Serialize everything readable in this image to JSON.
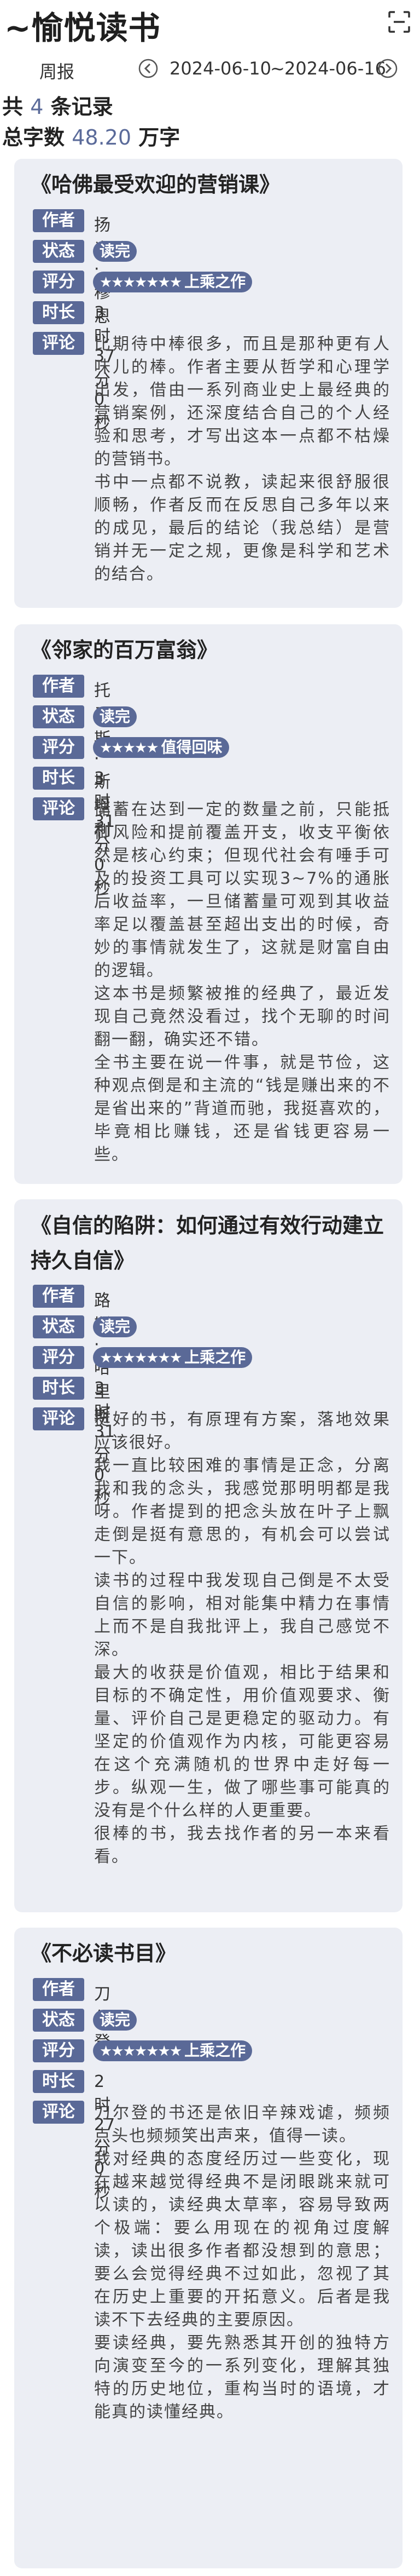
{
  "header": {
    "title": "~愉悦读书",
    "scan_icon": "scan-icon"
  },
  "range": {
    "label": "周报",
    "start": "2024-06-10",
    "separator": "~",
    "end": "2024-06-16",
    "prev_icon": "chevron-left-circle-icon",
    "next_icon": "chevron-right-circle-icon"
  },
  "summary": {
    "count_prefix": "共",
    "count": "4",
    "count_suffix": "条记录",
    "words_prefix": "总字数",
    "words": "48.20",
    "words_suffix": "万字"
  },
  "labels": {
    "author": "作者",
    "status": "状态",
    "rating": "评分",
    "duration": "时长",
    "review": "评论"
  },
  "colors": {
    "accent": "#5a6997",
    "card_bg": "#eceef4"
  },
  "books": [
    {
      "title": "《哈佛最受欢迎的营销课》",
      "author": "扬米·穆恩",
      "status": "读完",
      "stars": "★★★★★★★",
      "rating_text": "上乘之作",
      "duration": "3时37分0秒",
      "review": [
        "比期待中棒很多，而且是那种更有人味儿的棒。作者主要从哲学和心理学出发，借由一系列商业史上最经典的营销案例，还深度结合自己的个人经验和思考，才写出这本一点都不枯燥的营销书。",
        "书中一点都不说教，读起来很舒服很顺畅，作者反而在反思自己多年以来的成见，最后的结论（我总结）是营销并无一定之规，更像是科学和艺术的结合。"
      ]
    },
    {
      "title": "《邻家的百万富翁》",
      "author": "托马斯·斯坦利",
      "status": "读完",
      "stars": "★★★★★",
      "rating_text": "值得回味",
      "duration": "3时31分0秒",
      "review": [
        "储蓄在达到一定的数量之前，只能抵御风险和提前覆盖开支，收支平衡依然是核心约束；但现代社会有唾手可及的投资工具可以实现3~7%的通胀后收益率，一旦储蓄量可观到其收益率足以覆盖甚至超出支出的时候，奇妙的事情就发生了，这就是财富自由的逻辑。",
        "这本书是频繁被推的经典了，最近发现自己竟然没看过，找个无聊的时间翻一翻，确实还不错。",
        "全书主要在说一件事，就是节俭，这种观点倒是和主流的“钱是赚出来的不是省出来的”背道而驰，我挺喜欢的，毕竟相比赚钱，还是省钱更容易一些。"
      ]
    },
    {
      "title": "《自信的陷阱：如何通过有效行动建立持久自信》",
      "author": "路斯·哈里斯",
      "status": "读完",
      "stars": "★★★★★★★",
      "rating_text": "上乘之作",
      "duration": "3时31分0秒",
      "review": [
        "挺好的书，有原理有方案，落地效果应该很好。",
        "我一直比较困难的事情是正念，分离我和我的念头，我感觉那明明都是我呀。作者提到的把念头放在叶子上飘走倒是挺有意思的，有机会可以尝试一下。",
        "读书的过程中我发现自己倒是不太受自信的影响，相对能集中精力在事情上而不是自我批评上，我自己感觉不深。",
        "最大的收获是价值观，相比于结果和目标的不确定性，用价值观要求、衡量、评价自己是更稳定的驱动力。有坚定的价值观作为内核，可能更容易在这个充满随机的世界中走好每一步。纵观一生，做了哪些事可能真的没有是个什么样的人更重要。",
        "很棒的书，我去找作者的另一本来看看。"
      ]
    },
    {
      "title": "《不必读书目》",
      "author": "刀尔登",
      "status": "读完",
      "stars": "★★★★★★★",
      "rating_text": "上乘之作",
      "duration": "2时27分0秒",
      "review": [
        "刀尔登的书还是依旧辛辣戏谑，频频点头也频频笑出声来，值得一读。",
        "我对经典的态度经历过一些变化，现在越来越觉得经典不是闭眼跳来就可以读的，读经典太草率，容易导致两个极端：要么用现在的视角过度解读，读出很多作者都没想到的意思；要么会觉得经典不过如此，忽视了其在历史上重要的开拓意义。后者是我读不下去经典的主要原因。",
        "要读经典，要先熟悉其开创的独特方向演变至今的一系列变化，理解其独特的历史地位，重构当时的语境，才能真的读懂经典。"
      ]
    }
  ]
}
